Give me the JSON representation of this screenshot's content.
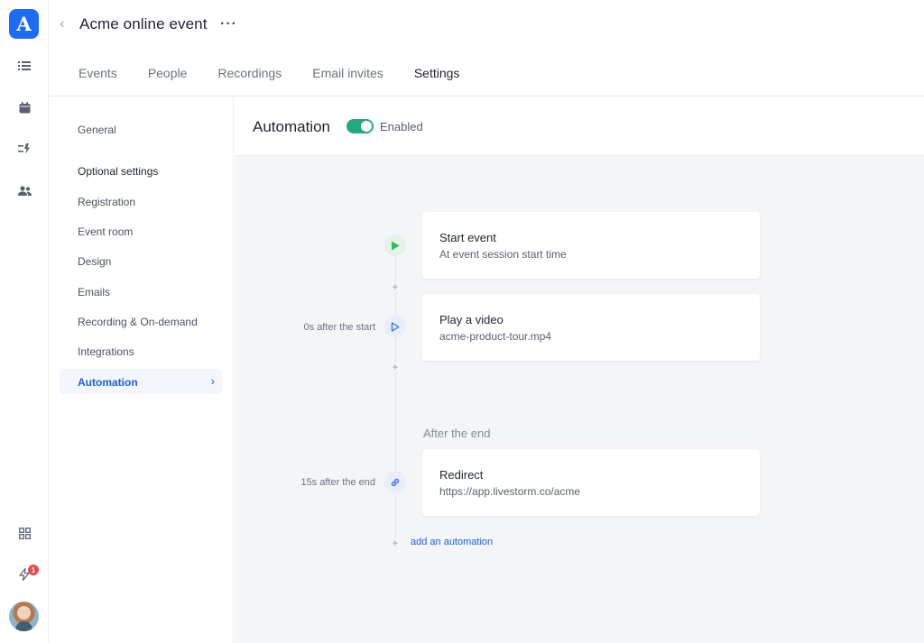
{
  "rail": {
    "logo_letter": "A",
    "notification_count": "1"
  },
  "header": {
    "title": "Acme online event",
    "tabs": [
      {
        "label": "Events"
      },
      {
        "label": "People"
      },
      {
        "label": "Recordings"
      },
      {
        "label": "Email invites"
      },
      {
        "label": "Settings"
      }
    ],
    "active_tab": "Settings"
  },
  "sidebar": {
    "general": "General",
    "section_title": "Optional settings",
    "items": [
      {
        "label": "Registration"
      },
      {
        "label": "Event room"
      },
      {
        "label": "Design"
      },
      {
        "label": "Emails"
      },
      {
        "label": "Recording & On-demand"
      },
      {
        "label": "Integrations"
      }
    ],
    "active_item": "Automation"
  },
  "main": {
    "title": "Automation",
    "toggle_state": "Enabled",
    "steps": [
      {
        "when": "",
        "title": "Start event",
        "subtitle": "At event session start time",
        "icon": "play-icon"
      },
      {
        "when": "0s after the start",
        "title": "Play a video",
        "subtitle": "acme-product-tour.mp4",
        "icon": "play-outline-icon"
      },
      {
        "when": "15s after the end",
        "title": "Redirect",
        "subtitle": "https://app.livestorm.co/acme",
        "icon": "link-icon"
      }
    ],
    "after_end_label": "After the end",
    "add_automation_label": "add an automation"
  },
  "colors": {
    "brand": "#1f6cf2",
    "toggle_on": "#23a97c",
    "link": "#1f5fd6"
  }
}
